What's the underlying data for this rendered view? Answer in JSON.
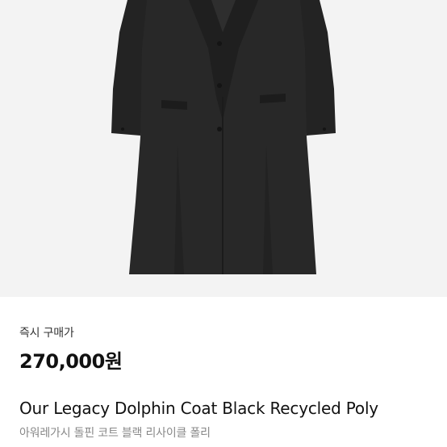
{
  "product": {
    "image_icon": "coat-photo",
    "purchase_type": "즉시 구매가",
    "price": "270,000원",
    "name_en": "Our Legacy Dolphin Coat Black Recycled Poly",
    "name_ko": "아워레가시 돌핀 코트 블랙 리사이클 폴리"
  },
  "colors": {
    "image_background": "#f3f3f3",
    "coat": "#262626",
    "price_text": "#111111",
    "subtitle_text": "#888888"
  }
}
